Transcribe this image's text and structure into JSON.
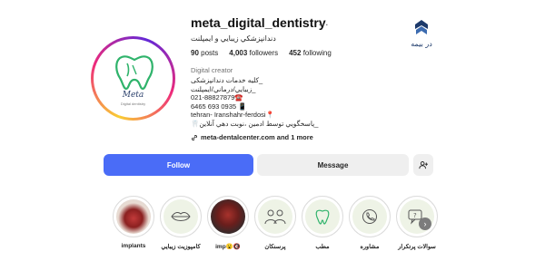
{
  "profile": {
    "username": "meta_digital_dentistry",
    "more_icon": "…",
    "full_name": "دندانپزشكي زيبايي و ايمپلنت",
    "avatar": {
      "brand": "Meta",
      "brand_sub": "Digital dentistry"
    },
    "stats": {
      "posts": "90",
      "posts_label": "posts",
      "followers": "4,003",
      "followers_label": "followers",
      "following": "452",
      "following_label": "following"
    },
    "category": "Digital creator",
    "bio": [
      "_كليه خدمات دندانپزشكی",
      "_زيبايي/درماني/ايمپلنت",
      "021-88827879☎️",
      "6465 693 0935 📱",
      "tehran- Iranshahr-ferdosi📍",
      "_پاسخگويي توسط ادمين ،نوبت دهي آنلاين🦷"
    ],
    "link": "meta-dentalcenter.com and 1 more"
  },
  "top_logo": {
    "caption": "در بیمه"
  },
  "actions": {
    "follow": "Follow",
    "message": "Message",
    "suggest_icon": "person-add-icon"
  },
  "highlights": [
    {
      "label": "implants"
    },
    {
      "label": "كامپوزيت زيبايي"
    },
    {
      "label": "imp😮🔇"
    },
    {
      "label": "پرسنكان"
    },
    {
      "label": "مطب"
    },
    {
      "label": "مشاوره"
    },
    {
      "label": "سوالات پرتكرار"
    }
  ],
  "colors": {
    "follow": "#4a6cf7",
    "secondary": "#efefef",
    "highlight_bg": "#eef3e6"
  }
}
